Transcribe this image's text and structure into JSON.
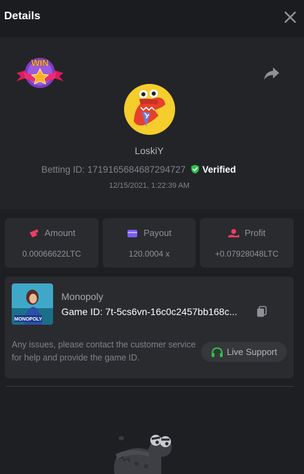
{
  "header": {
    "title": "Details"
  },
  "bet": {
    "username": "LoskiY",
    "betting_id": "Betting ID: 1719165684687294727",
    "verified_label": "Verified",
    "timestamp": "12/15/2021, 1:22:39 AM",
    "badge_text": "WIN"
  },
  "stats": [
    {
      "label": "Amount",
      "value": "0.00066622LTC",
      "icon": "amount-icon"
    },
    {
      "label": "Payout",
      "value": "120.0004 x",
      "icon": "wallet-icon"
    },
    {
      "label": "Profit",
      "value": "+0.07928048LTC",
      "icon": "profit-icon"
    }
  ],
  "game": {
    "name": "Monopoly",
    "id": "Game ID: 7t-5cs6vn-16c0c2457bb168c...",
    "thumb_text": "MONOPOLY"
  },
  "support": {
    "help_text": "Any issues, please contact the customer service for help and provide the game ID.",
    "button_label": "Live Support"
  },
  "colors": {
    "verified": "#2fc24a",
    "support_icon": "#2fc24a",
    "accent_red": "#ea3f62",
    "accent_purple": "#7b5cf0"
  }
}
